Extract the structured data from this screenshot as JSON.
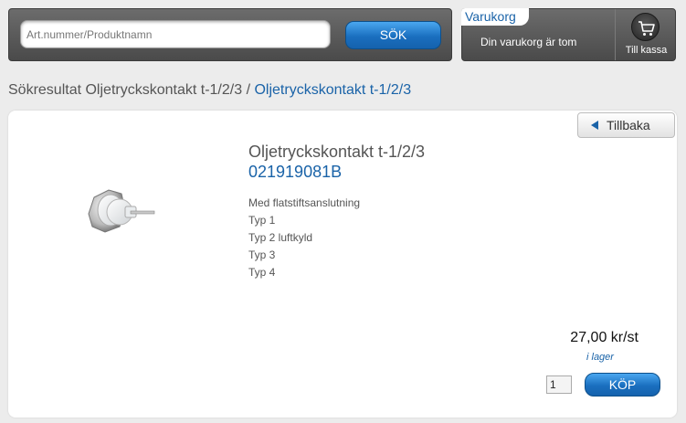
{
  "search": {
    "placeholder": "Art.nummer/Produktnamn",
    "button_label": "SÖK"
  },
  "cart": {
    "title": "Varukorg",
    "status": "Din varukorg är tom",
    "checkout_label": "Till kassa",
    "icon": "shopping-cart-icon"
  },
  "breadcrumb": {
    "prefix": "Sökresultat Oljetryckskontakt t-1/2/3",
    "separator": "/",
    "current": "Oljetryckskontakt t-1/2/3"
  },
  "back_button": {
    "label": "Tillbaka",
    "icon": "left-arrow-icon"
  },
  "product": {
    "name": "Oljetryckskontakt t-1/2/3",
    "code": "021919081B",
    "description": [
      "Med flatstiftsanslutning",
      "Typ 1",
      "Typ 2 luftkyld",
      "Typ 3",
      "Typ 4"
    ],
    "price": "27,00 kr/st",
    "stock": "i lager",
    "quantity": "1",
    "buy_label": "KÖP"
  },
  "colors": {
    "accent": "#1a63a8",
    "header_bg": "#5a5a5a",
    "button_blue": "#1a6fbf"
  }
}
